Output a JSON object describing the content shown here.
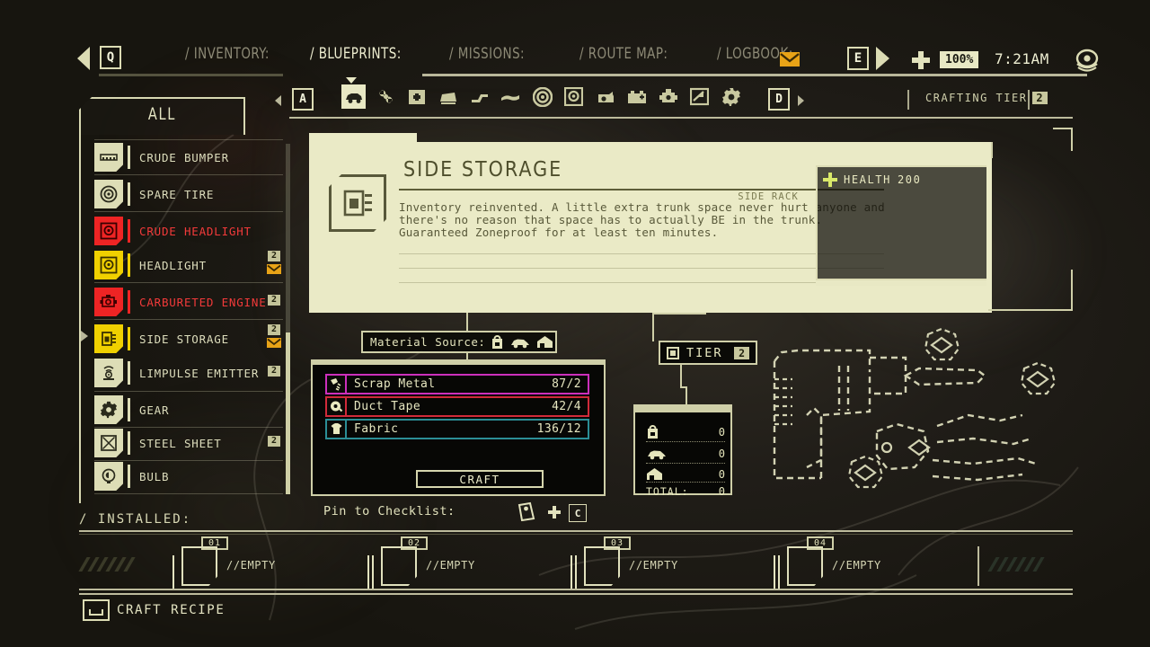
{
  "topnav": {
    "back_key": "Q",
    "forward_key": "E",
    "tabs": [
      {
        "label": "/ INVENTORY:",
        "active": false
      },
      {
        "label": "/ BLUEPRINTS:",
        "active": true
      },
      {
        "label": "/ MISSIONS:",
        "active": false
      },
      {
        "label": "/ ROUTE MAP:",
        "active": false
      },
      {
        "label": "/ LOGBOOK:",
        "active": false
      }
    ],
    "battery_percent": "100%",
    "clock": "7:21AM",
    "icons": [
      "back-arrow-icon",
      "forward-arrow-icon",
      "plus-icon",
      "envelope-icon",
      "eye-icon"
    ]
  },
  "category": {
    "left_key": "A",
    "right_key": "D",
    "crafting_tier_label": "CRAFTING TIER",
    "crafting_tier_value": "2",
    "icons": [
      {
        "name": "car-body-icon",
        "selected": true
      },
      {
        "name": "fan-icon",
        "selected": false
      },
      {
        "name": "medkit-icon",
        "selected": false
      },
      {
        "name": "car-door-icon",
        "selected": false
      },
      {
        "name": "suspension-icon",
        "selected": false
      },
      {
        "name": "bumper-icon",
        "selected": false
      },
      {
        "name": "tire-icon",
        "selected": false
      },
      {
        "name": "headlight-icon",
        "selected": false
      },
      {
        "name": "oil-can-icon",
        "selected": false
      },
      {
        "name": "battery-icon",
        "selected": false
      },
      {
        "name": "engine-icon",
        "selected": false
      },
      {
        "name": "gauge-icon",
        "selected": false
      },
      {
        "name": "gear-icon",
        "selected": false
      }
    ]
  },
  "sidebar": {
    "filter_tab": "ALL",
    "items": [
      {
        "label": "CRUDE BUMPER",
        "state": "normal",
        "badge": "",
        "envelope": false,
        "icon": "bumper-icon"
      },
      {
        "label": "SPARE TIRE",
        "state": "normal",
        "badge": "",
        "envelope": false,
        "icon": "tire-icon"
      },
      {
        "label": "CRUDE HEADLIGHT",
        "state": "locked",
        "badge": "",
        "envelope": false,
        "icon": "headlight-icon"
      },
      {
        "label": "HEADLIGHT",
        "state": "new",
        "badge": "2",
        "envelope": true,
        "icon": "headlight-icon"
      },
      {
        "label": "CARBURETED ENGINE",
        "state": "locked",
        "badge": "2",
        "envelope": false,
        "icon": "engine-icon"
      },
      {
        "label": "SIDE STORAGE",
        "state": "selected",
        "badge": "2",
        "envelope": true,
        "icon": "storage-icon"
      },
      {
        "label": "LIMPULSE EMITTER",
        "state": "normal",
        "badge": "2",
        "envelope": false,
        "icon": "emitter-icon"
      },
      {
        "label": "GEAR",
        "state": "normal",
        "badge": "",
        "envelope": false,
        "icon": "gear-icon"
      },
      {
        "label": "STEEL SHEET",
        "state": "normal",
        "badge": "2",
        "envelope": false,
        "icon": "sheet-icon"
      },
      {
        "label": "BULB",
        "state": "normal",
        "badge": "",
        "envelope": false,
        "icon": "bulb-icon"
      }
    ]
  },
  "detail": {
    "title": "SIDE STORAGE",
    "subtitle": "SIDE RACK",
    "description": "Inventory reinvented. A little extra trunk space never hurt anyone and there's no reason that space has to actually BE in the trunk. Guaranteed Zoneproof for at least ten minutes.",
    "icon": "side-storage-icon"
  },
  "health": {
    "label": "HEALTH",
    "value": "200",
    "icon": "health-cross-icon"
  },
  "material_source": {
    "label": "Material Source:",
    "icons": [
      "backpack-icon",
      "car-icon",
      "home-icon"
    ]
  },
  "materials": {
    "rows": [
      {
        "name": "Scrap Metal",
        "qty": "87/2",
        "color": "#cc2fbb",
        "icon": "scrap-metal-icon"
      },
      {
        "name": "Duct Tape",
        "qty": "42/4",
        "color": "#d02a3a",
        "icon": "duct-tape-icon"
      },
      {
        "name": "Fabric",
        "qty": "136/12",
        "color": "#2b8e96",
        "icon": "fabric-icon"
      }
    ],
    "craft_label": "CRAFT"
  },
  "tier": {
    "label": "TIER",
    "value": "2"
  },
  "breakdown": {
    "rows": [
      {
        "icon": "backpack-icon",
        "value": "0"
      },
      {
        "icon": "car-icon",
        "value": "0"
      },
      {
        "icon": "home-icon",
        "value": "0"
      }
    ],
    "total_label": "TOTAL:",
    "total_value": "0"
  },
  "pin": {
    "label": "Pin to Checklist:",
    "key": "C",
    "icons": [
      "clipboard-icon",
      "plus-icon"
    ]
  },
  "installed": {
    "label": "/ INSTALLED:",
    "slots": [
      {
        "number": "01",
        "status": "//EMPTY"
      },
      {
        "number": "02",
        "status": "//EMPTY"
      },
      {
        "number": "03",
        "status": "//EMPTY"
      },
      {
        "number": "04",
        "status": "//EMPTY"
      }
    ]
  },
  "bottombar": {
    "action_label": "CRAFT RECIPE",
    "key": "space-key"
  },
  "colors": {
    "cream": "#e8e8c4",
    "panel_cream": "#eaeac6",
    "dark": "#1a1813",
    "locked_red": "#ee2424",
    "selected_yellow": "#f0d000",
    "envelope_orange": "#e8a317"
  }
}
